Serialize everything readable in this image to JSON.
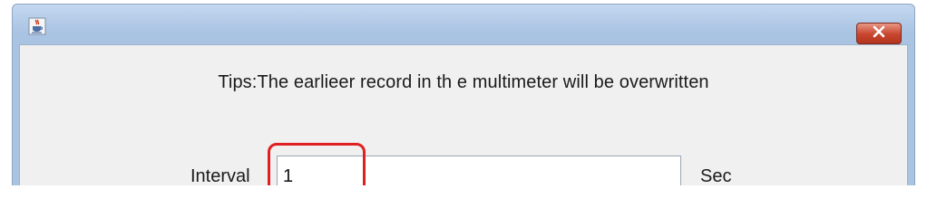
{
  "dialog": {
    "tips": "Tips:The earlieer record in th e multimeter will be overwritten",
    "interval_label": "Interval",
    "interval_value": "1",
    "unit": "Sec"
  },
  "icons": {
    "app": "java-coffee-icon",
    "close": "close-icon"
  },
  "colors": {
    "close_button": "#c8452e",
    "highlight": "#e02020",
    "titlebar": "#a9c3e3"
  }
}
